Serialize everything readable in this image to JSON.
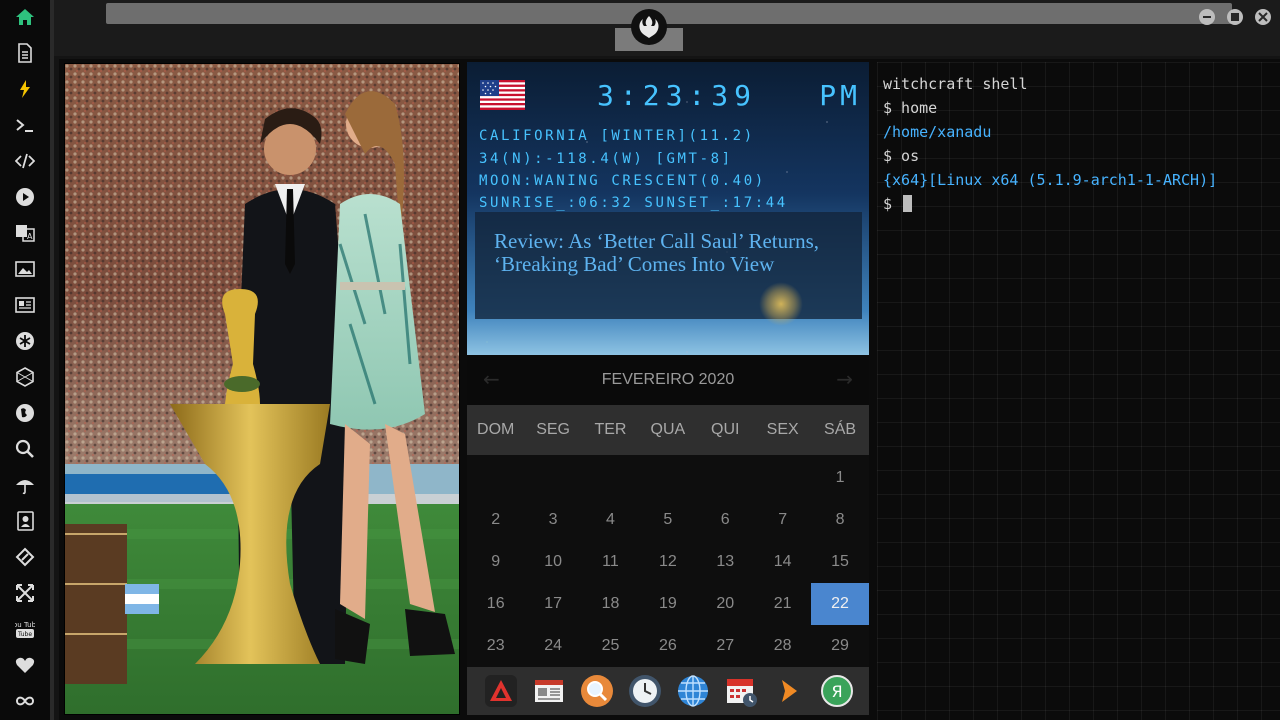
{
  "rail": {
    "icons": [
      "home-icon",
      "document-icon",
      "bolt-icon",
      "terminal-icon",
      "code-icon",
      "play-icon",
      "translate-icon",
      "image-icon",
      "news-icon",
      "asterisk-icon",
      "hexagon-icon",
      "globe-icon",
      "search-icon",
      "umbrella-icon",
      "contact-icon",
      "tag-icon",
      "expand-icon",
      "youtube-icon",
      "heart-icon",
      "infinity-icon"
    ],
    "accent": "#2ec27e",
    "youtube_label": "You Tube"
  },
  "window": {
    "title_logo": "rebel-alliance-icon"
  },
  "clock": {
    "time": "3:23:39",
    "ampm": "PM",
    "location": "CALIFORNIA [WINTER](11.2)",
    "coords": "34(N):-118.4(W) [GMT-8]",
    "moon": "MOON:WANING CRESCENT(0.40)",
    "sun": "SUNRISE_:06:32 SUNSET_:17:44",
    "color": "#47c3ff"
  },
  "news": {
    "headline": "Review: As ‘Better Call Saul’ Returns, ‘Breaking Bad’ Comes Into View"
  },
  "calendar": {
    "month_label": "FEVEREIRO 2020",
    "prev": "←",
    "next": "→",
    "weekdays": [
      "DOM",
      "SEG",
      "TER",
      "QUA",
      "QUI",
      "SEX",
      "SÁB"
    ],
    "weeks": [
      [
        "",
        "",
        "",
        "",
        "",
        "",
        "1"
      ],
      [
        "2",
        "3",
        "4",
        "5",
        "6",
        "7",
        "8"
      ],
      [
        "9",
        "10",
        "11",
        "12",
        "13",
        "14",
        "15"
      ],
      [
        "16",
        "17",
        "18",
        "19",
        "20",
        "21",
        "22"
      ],
      [
        "23",
        "24",
        "25",
        "26",
        "27",
        "28",
        "29"
      ]
    ],
    "today": "22",
    "today_color": "#4a86cf"
  },
  "dock": {
    "apps": [
      "app-launcher-icon",
      "newspaper-icon",
      "magnifier-icon",
      "clock-icon",
      "globe-icon",
      "calendar-icon",
      "arrow-icon",
      "yandex-icon"
    ],
    "yandex_letter": "Я"
  },
  "terminal": {
    "lines": [
      {
        "text": "witchcraft shell",
        "style": "normal"
      },
      {
        "text": "$ home",
        "style": "normal"
      },
      {
        "text": "/home/xanadu",
        "style": "blue"
      },
      {
        "text": "$ os",
        "style": "normal"
      },
      {
        "text": "{x64}[Linux x64 (5.1.9-arch1-1-ARCH)]",
        "style": "blue"
      }
    ],
    "prompt": "$ "
  }
}
